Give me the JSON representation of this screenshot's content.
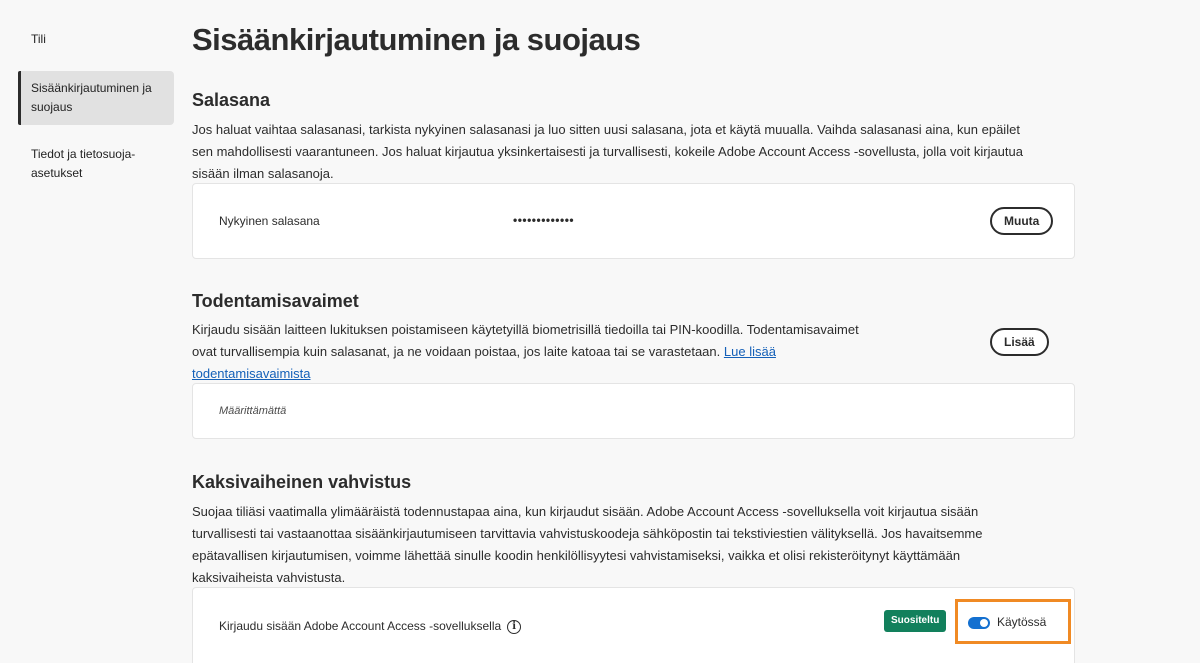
{
  "sidebar": {
    "items": [
      {
        "label": "Tili"
      },
      {
        "label": "Sisäänkirjautuminen ja suojaus"
      },
      {
        "label": "Tiedot ja tietosuoja-asetukset"
      }
    ]
  },
  "page": {
    "title": "Sisäänkirjautuminen ja suojaus"
  },
  "password": {
    "title": "Salasana",
    "description": "Jos haluat vaihtaa salasanasi, tarkista nykyinen salasanasi ja luo sitten uusi salasana, jota et käytä muualla. Vaihda salasanasi aina, kun epäilet sen mahdollisesti vaarantuneen. Jos haluat kirjautua yksinkertaisesti ja turvallisesti, kokeile Adobe Account Access -sovellusta, jolla voit kirjautua sisään ilman salasanoja.",
    "current_label": "Nykyinen salasana",
    "masked_value": "•••••••••••••",
    "change_button": "Muuta"
  },
  "passkeys": {
    "title": "Todentamisavaimet",
    "description": "Kirjaudu sisään laitteen lukituksen poistamiseen käytetyillä biometrisillä tiedoilla tai PIN-koodilla. Todentamisavaimet ovat turvallisempia kuin salasanat, ja ne voidaan poistaa, jos laite katoaa tai se varastetaan.",
    "learn_more_link": "Lue lisää todentamisavaimista",
    "add_button": "Lisää",
    "empty_state": "Määrittämättä"
  },
  "two_step": {
    "title": "Kaksivaiheinen vahvistus",
    "description": "Suojaa tiliäsi vaatimalla ylimääräistä todennustapaa aina, kun kirjaudut sisään. Adobe Account Access -sovelluksella voit kirjautua sisään turvallisesti tai vastaanottaa sisäänkirjautumiseen tarvittavia vahvistuskoodeja sähköpostin tai tekstiviestien välityksellä. Jos havaitsemme epätavallisen kirjautumisen, voimme lähettää sinulle koodin henkilöllisyytesi vahvistamiseksi, vaikka et olisi rekisteröitynyt käyttämään kaksivaiheista vahvistusta.",
    "app_label": "Kirjaudu sisään Adobe Account Access -sovelluksella",
    "info_glyph": "i",
    "recommended_badge": "Suositeltu",
    "toggle_label": "Käytössä",
    "toggle_on": true
  },
  "colors": {
    "accent_blue": "#1470d0",
    "badge_green": "#12805c",
    "highlight_orange": "#f08a24",
    "link_blue": "#1460b8"
  }
}
